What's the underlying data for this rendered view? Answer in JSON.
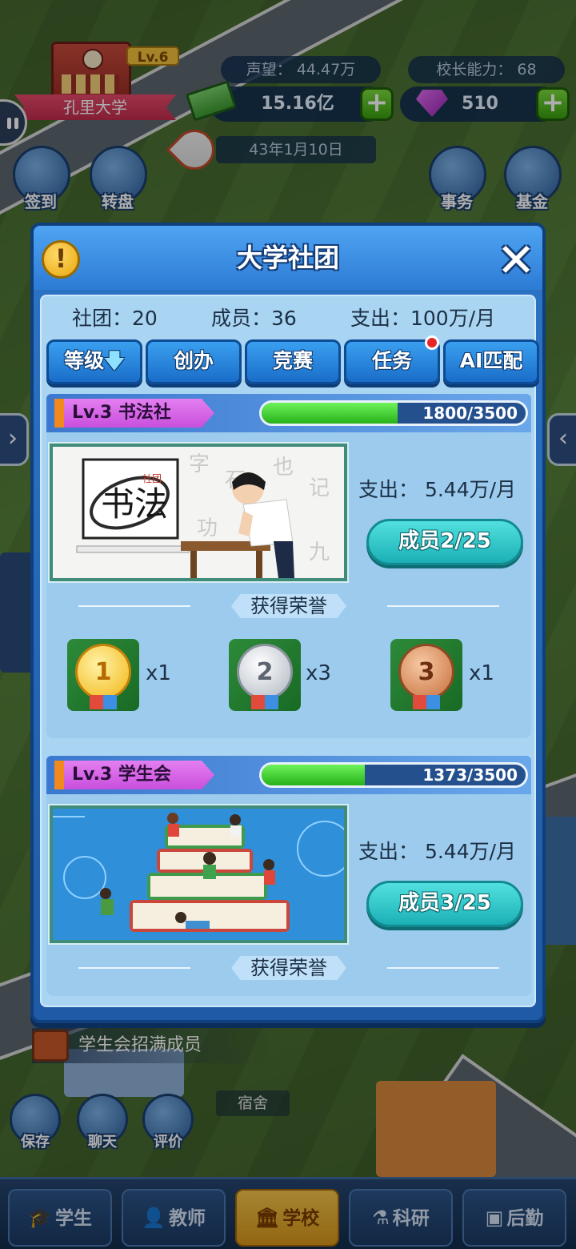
{
  "hud": {
    "school_level": "Lv.6",
    "school_name": "孔里大学",
    "reputation": "声望：  44.47万",
    "principal_ability": "校长能力：  68",
    "money": "15.16亿",
    "gems": "510",
    "plus": "+",
    "date": "43年1月10日",
    "left_buttons": [
      {
        "label": "签到"
      },
      {
        "label": "转盘"
      }
    ],
    "right_buttons": [
      {
        "label": "事务"
      },
      {
        "label": "基金"
      }
    ],
    "task_banner": "学生会招满成员",
    "dorm_label": "宿舍",
    "tools": [
      {
        "label": "保存"
      },
      {
        "label": "聊天"
      },
      {
        "label": "评价"
      }
    ]
  },
  "bottom_nav": [
    {
      "label": "学生",
      "icon": "🎓"
    },
    {
      "label": "教师",
      "icon": "👤"
    },
    {
      "label": "学校",
      "icon": "🏛"
    },
    {
      "label": "科研",
      "icon": "⚗"
    },
    {
      "label": "后勤",
      "icon": "▣"
    }
  ],
  "modal": {
    "title": "大学社团",
    "info": "!",
    "close": "✕",
    "summary": {
      "clubs": "社团：20",
      "members": "成员：36",
      "expense": "支出：100万/月"
    },
    "tabs": [
      {
        "label": "等级",
        "arrow": "🡇"
      },
      {
        "label": "创办"
      },
      {
        "label": "竞赛"
      },
      {
        "label": "任务"
      },
      {
        "label": "AI匹配"
      }
    ],
    "clubs": [
      {
        "name": "Lv.3  书法社",
        "progress_text": "1800/3500",
        "progress": 0.514,
        "cost": "支出：  5.44万/月",
        "member_button": "成员2/25",
        "honor_title": "获得荣誉",
        "image_logo": "书法",
        "image_seal": "社团",
        "medals": [
          {
            "num": "1",
            "count": "x1",
            "kind": "gold"
          },
          {
            "num": "2",
            "count": "x3",
            "kind": "silver"
          },
          {
            "num": "3",
            "count": "x1",
            "kind": "bronze"
          }
        ]
      },
      {
        "name": "Lv.3  学生会",
        "progress_text": "1373/3500",
        "progress": 0.392,
        "cost": "支出：  5.44万/月",
        "member_button": "成员3/25",
        "honor_title": "获得荣誉"
      }
    ]
  }
}
